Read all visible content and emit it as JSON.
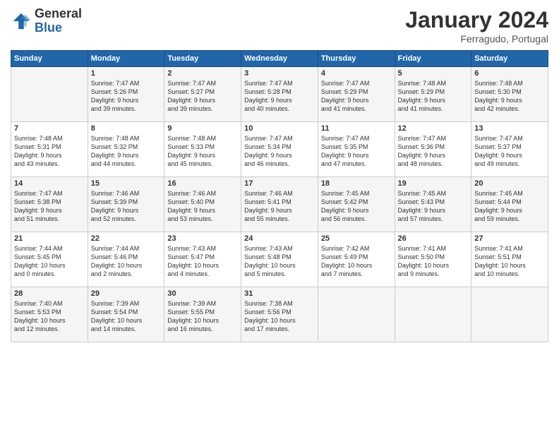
{
  "logo": {
    "general": "General",
    "blue": "Blue"
  },
  "title": "January 2024",
  "subtitle": "Ferragudo, Portugal",
  "columns": [
    "Sunday",
    "Monday",
    "Tuesday",
    "Wednesday",
    "Thursday",
    "Friday",
    "Saturday"
  ],
  "weeks": [
    [
      {
        "day": "",
        "info": ""
      },
      {
        "day": "1",
        "info": "Sunrise: 7:47 AM\nSunset: 5:26 PM\nDaylight: 9 hours\nand 39 minutes."
      },
      {
        "day": "2",
        "info": "Sunrise: 7:47 AM\nSunset: 5:27 PM\nDaylight: 9 hours\nand 39 minutes."
      },
      {
        "day": "3",
        "info": "Sunrise: 7:47 AM\nSunset: 5:28 PM\nDaylight: 9 hours\nand 40 minutes."
      },
      {
        "day": "4",
        "info": "Sunrise: 7:47 AM\nSunset: 5:29 PM\nDaylight: 9 hours\nand 41 minutes."
      },
      {
        "day": "5",
        "info": "Sunrise: 7:48 AM\nSunset: 5:29 PM\nDaylight: 9 hours\nand 41 minutes."
      },
      {
        "day": "6",
        "info": "Sunrise: 7:48 AM\nSunset: 5:30 PM\nDaylight: 9 hours\nand 42 minutes."
      }
    ],
    [
      {
        "day": "7",
        "info": "Sunrise: 7:48 AM\nSunset: 5:31 PM\nDaylight: 9 hours\nand 43 minutes."
      },
      {
        "day": "8",
        "info": "Sunrise: 7:48 AM\nSunset: 5:32 PM\nDaylight: 9 hours\nand 44 minutes."
      },
      {
        "day": "9",
        "info": "Sunrise: 7:48 AM\nSunset: 5:33 PM\nDaylight: 9 hours\nand 45 minutes."
      },
      {
        "day": "10",
        "info": "Sunrise: 7:47 AM\nSunset: 5:34 PM\nDaylight: 9 hours\nand 46 minutes."
      },
      {
        "day": "11",
        "info": "Sunrise: 7:47 AM\nSunset: 5:35 PM\nDaylight: 9 hours\nand 47 minutes."
      },
      {
        "day": "12",
        "info": "Sunrise: 7:47 AM\nSunset: 5:36 PM\nDaylight: 9 hours\nand 48 minutes."
      },
      {
        "day": "13",
        "info": "Sunrise: 7:47 AM\nSunset: 5:37 PM\nDaylight: 9 hours\nand 49 minutes."
      }
    ],
    [
      {
        "day": "14",
        "info": "Sunrise: 7:47 AM\nSunset: 5:38 PM\nDaylight: 9 hours\nand 51 minutes."
      },
      {
        "day": "15",
        "info": "Sunrise: 7:46 AM\nSunset: 5:39 PM\nDaylight: 9 hours\nand 52 minutes."
      },
      {
        "day": "16",
        "info": "Sunrise: 7:46 AM\nSunset: 5:40 PM\nDaylight: 9 hours\nand 53 minutes."
      },
      {
        "day": "17",
        "info": "Sunrise: 7:46 AM\nSunset: 5:41 PM\nDaylight: 9 hours\nand 55 minutes."
      },
      {
        "day": "18",
        "info": "Sunrise: 7:45 AM\nSunset: 5:42 PM\nDaylight: 9 hours\nand 56 minutes."
      },
      {
        "day": "19",
        "info": "Sunrise: 7:45 AM\nSunset: 5:43 PM\nDaylight: 9 hours\nand 57 minutes."
      },
      {
        "day": "20",
        "info": "Sunrise: 7:45 AM\nSunset: 5:44 PM\nDaylight: 9 hours\nand 59 minutes."
      }
    ],
    [
      {
        "day": "21",
        "info": "Sunrise: 7:44 AM\nSunset: 5:45 PM\nDaylight: 10 hours\nand 0 minutes."
      },
      {
        "day": "22",
        "info": "Sunrise: 7:44 AM\nSunset: 5:46 PM\nDaylight: 10 hours\nand 2 minutes."
      },
      {
        "day": "23",
        "info": "Sunrise: 7:43 AM\nSunset: 5:47 PM\nDaylight: 10 hours\nand 4 minutes."
      },
      {
        "day": "24",
        "info": "Sunrise: 7:43 AM\nSunset: 5:48 PM\nDaylight: 10 hours\nand 5 minutes."
      },
      {
        "day": "25",
        "info": "Sunrise: 7:42 AM\nSunset: 5:49 PM\nDaylight: 10 hours\nand 7 minutes."
      },
      {
        "day": "26",
        "info": "Sunrise: 7:41 AM\nSunset: 5:50 PM\nDaylight: 10 hours\nand 9 minutes."
      },
      {
        "day": "27",
        "info": "Sunrise: 7:41 AM\nSunset: 5:51 PM\nDaylight: 10 hours\nand 10 minutes."
      }
    ],
    [
      {
        "day": "28",
        "info": "Sunrise: 7:40 AM\nSunset: 5:53 PM\nDaylight: 10 hours\nand 12 minutes."
      },
      {
        "day": "29",
        "info": "Sunrise: 7:39 AM\nSunset: 5:54 PM\nDaylight: 10 hours\nand 14 minutes."
      },
      {
        "day": "30",
        "info": "Sunrise: 7:39 AM\nSunset: 5:55 PM\nDaylight: 10 hours\nand 16 minutes."
      },
      {
        "day": "31",
        "info": "Sunrise: 7:38 AM\nSunset: 5:56 PM\nDaylight: 10 hours\nand 17 minutes."
      },
      {
        "day": "",
        "info": ""
      },
      {
        "day": "",
        "info": ""
      },
      {
        "day": "",
        "info": ""
      }
    ]
  ]
}
